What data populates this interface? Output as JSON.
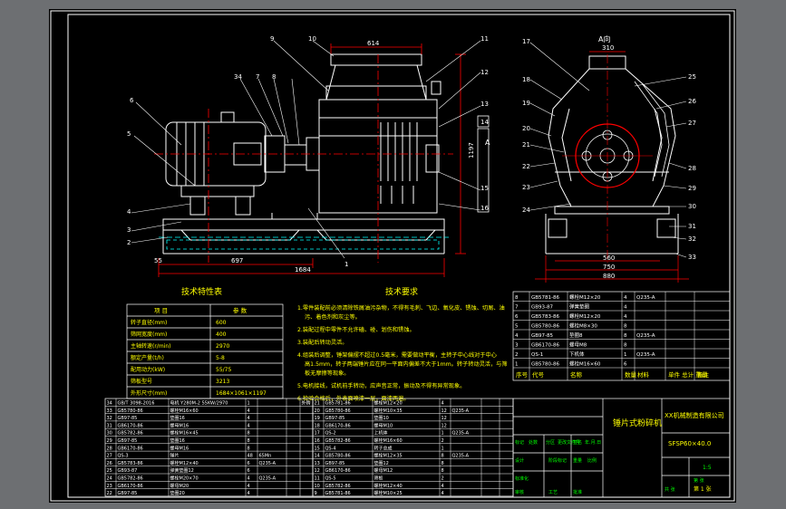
{
  "colors": {
    "viewport_bg": "#6d6f72",
    "sheet_bg": "#000000",
    "outline": "#ffffff",
    "dimension": "#ff0000",
    "centerline": "#ff0000",
    "annotation": "#ffff00",
    "hidden": "#00ffff",
    "title_accent": "#00ff00"
  },
  "views": {
    "front": {
      "dim_top": "614",
      "dim_bottom_left": "697",
      "dim_bottom_total": "1684",
      "dim_left_small": "55",
      "dim_height": "1197",
      "section_label": "A",
      "callouts": [
        "1",
        "2",
        "3",
        "4",
        "5",
        "6",
        "7",
        "34",
        "8",
        "9",
        "10",
        "11",
        "12",
        "13",
        "14",
        "15",
        "16"
      ]
    },
    "side": {
      "title": "A向",
      "dim_top": "310",
      "dim_bottom_1": "560",
      "dim_bottom_2": "750",
      "dim_bottom_3": "880",
      "callouts_left": [
        "17",
        "18",
        "19",
        "20",
        "21",
        "22",
        "23",
        "24"
      ],
      "callouts_right": [
        "25",
        "26",
        "27",
        "28",
        "29",
        "30",
        "31",
        "32",
        "33"
      ]
    }
  },
  "tech_perf": {
    "title": "技术特性表",
    "headers": [
      "项  目",
      "参  数"
    ],
    "rows": [
      [
        "转子直径(mm)",
        "600"
      ],
      [
        "筛网宽度(mm)",
        "400"
      ],
      [
        "主轴转速(r/min)",
        "2970"
      ],
      [
        "额定产量(t/h)",
        "5-8"
      ],
      [
        "配用动力(kW)",
        "55/75"
      ],
      [
        "筛板型号",
        "3213"
      ],
      [
        "外形尺寸(mm)",
        "1684×1061×1197"
      ]
    ]
  },
  "tech_req": {
    "title": "技术要求",
    "items": [
      "1.零件装配前必须清除铁屑油污杂物，不得有毛刺、飞边、氧化皮、锈蚀、切屑、油污、着色剂和灰尘等。",
      "2.装配过程中零件不允许磕、碰、划伤和锈蚀。",
      "3.装配后转动灵活。",
      "4.组装后调整，锤架偏摆不超过0.5毫米，需要做动平衡，主转子中心线对于中心高1.5mm，转子两端锤片应在同一平面内偏差不大于1mm。转子转动灵活，与筛板无摩擦等现象。",
      "5.电机接线，试机前手转动，应声音正常，振动及不得有异常现象。",
      "6.检验合格后，外表面喷漆一层，面漆两遍。"
    ]
  },
  "parts_left": {
    "rows": [
      [
        "34",
        "GB/T 3098-2016",
        "电机 Y280M-2 55KW/2970",
        "1",
        "",
        "",
        "外购"
      ],
      [
        "33",
        "GB5780-86",
        "螺栓M16×60",
        "4",
        "",
        "",
        ""
      ],
      [
        "32",
        "GB97-85",
        "垫圈16",
        "4",
        "",
        "",
        ""
      ],
      [
        "31",
        "GB6170-86",
        "螺母M16",
        "4",
        "",
        "",
        ""
      ],
      [
        "30",
        "GB5782-86",
        "螺栓M16×45",
        "8",
        "",
        "",
        ""
      ],
      [
        "29",
        "GB97-85",
        "垫圈16",
        "8",
        "",
        "",
        ""
      ],
      [
        "28",
        "GB6170-86",
        "螺母M16",
        "8",
        "",
        "",
        ""
      ],
      [
        "27",
        "QS-3",
        "锤片",
        "48",
        "65Mn",
        "",
        ""
      ],
      [
        "26",
        "GB5783-86",
        "螺栓M12×40",
        "6",
        "Q235-A",
        "",
        ""
      ],
      [
        "25",
        "GB93-87",
        "弹簧垫圈12",
        "6",
        "",
        "",
        ""
      ],
      [
        "24",
        "GB5782-86",
        "螺栓M20×70",
        "4",
        "Q235-A",
        "",
        ""
      ],
      [
        "23",
        "GB6170-86",
        "螺母M20",
        "4",
        "",
        "",
        ""
      ],
      [
        "22",
        "GB97-85",
        "垫圈20",
        "4",
        "",
        "",
        ""
      ]
    ]
  },
  "parts_mid": {
    "rows": [
      [
        "21",
        "GB5781-86",
        "螺栓M12×20",
        "4",
        "",
        "",
        ""
      ],
      [
        "20",
        "GB5780-86",
        "螺栓M10×35",
        "12",
        "Q235-A",
        "",
        ""
      ],
      [
        "19",
        "GB97-85",
        "垫圈10",
        "12",
        "",
        "",
        ""
      ],
      [
        "18",
        "GB6170-86",
        "螺母M10",
        "12",
        "",
        "",
        ""
      ],
      [
        "17",
        "QS-2",
        "上机体",
        "1",
        "Q235-A",
        "",
        ""
      ],
      [
        "16",
        "GB5782-86",
        "螺栓M16×60",
        "2",
        "",
        "",
        ""
      ],
      [
        "15",
        "QS-4",
        "转子总成",
        "1",
        "",
        "",
        ""
      ],
      [
        "14",
        "GB5780-86",
        "螺栓M12×35",
        "8",
        "Q235-A",
        "",
        ""
      ],
      [
        "13",
        "GB97-85",
        "垫圈12",
        "8",
        "",
        "",
        ""
      ],
      [
        "12",
        "GB6170-86",
        "螺母M12",
        "8",
        "",
        "",
        ""
      ],
      [
        "11",
        "QS-5",
        "筛板",
        "2",
        "",
        "",
        ""
      ],
      [
        "10",
        "GB5782-86",
        "螺栓M12×40",
        "4",
        "",
        "",
        ""
      ],
      [
        "9",
        "GB5781-86",
        "螺栓M10×25",
        "4",
        "",
        "",
        ""
      ]
    ]
  },
  "parts_right": {
    "rows": [
      [
        "8",
        "GB5781-86",
        "螺栓M12×20",
        "4",
        "Q235-A",
        "",
        ""
      ],
      [
        "7",
        "GB93-87",
        "弹簧垫圈",
        "4",
        "",
        "",
        ""
      ],
      [
        "6",
        "GB5783-86",
        "螺栓M12×20",
        "4",
        "",
        "",
        ""
      ],
      [
        "5",
        "GB5780-86",
        "螺栓M8×30",
        "8",
        "",
        "",
        ""
      ],
      [
        "4",
        "GB97-85",
        "垫圈8",
        "8",
        "Q235-A",
        "",
        ""
      ],
      [
        "3",
        "GB6170-86",
        "螺母M8",
        "8",
        "",
        "",
        ""
      ],
      [
        "2",
        "QS-1",
        "下机体",
        "1",
        "Q235-A",
        "",
        ""
      ],
      [
        "1",
        "GB5780-86",
        "螺栓M16×60",
        "6",
        "",
        "",
        ""
      ]
    ],
    "header": [
      "序号",
      "代号",
      "名称",
      "数量",
      "材料",
      "单件 总计 重量",
      "备注"
    ]
  },
  "title_block": {
    "drawing_name": "锤片式粉碎机",
    "company": "XX机械制造有限公司",
    "drawing_no": "SFSP60×40.0",
    "labels": [
      "标记",
      "处数",
      "分区",
      "更改文件号",
      "签名",
      "年.月.日",
      "设计",
      "标准化",
      "阶段标记",
      "重量",
      "比例",
      "审核",
      "工艺",
      "批准",
      "共 张",
      "第 张"
    ],
    "scale": "1:5",
    "page": "第 1 张"
  }
}
